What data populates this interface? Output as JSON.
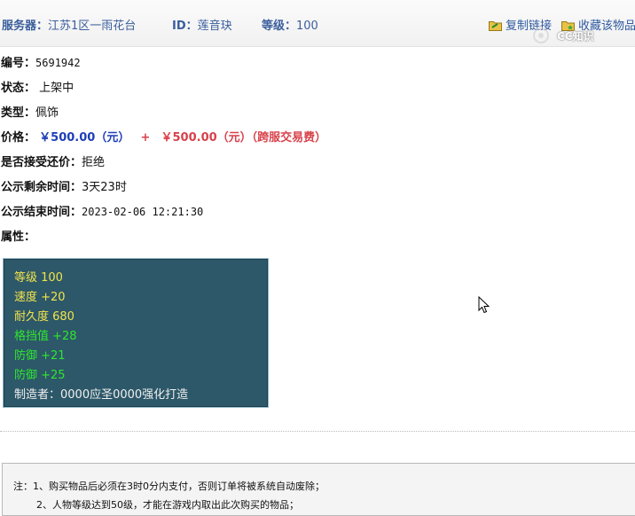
{
  "header": {
    "server_label": "服务器：",
    "server_value": "江苏1区一雨花台",
    "id_label": "ID：",
    "id_value": "莲音玦",
    "level_label": "等级：",
    "level_value": "100",
    "copy_link_label": "复制链接",
    "favorite_label": "收藏该物品"
  },
  "watermark": {
    "text": "CC知识"
  },
  "details": {
    "number_label": "编号：",
    "number_value": "5691942",
    "status_label": "状态：",
    "status_value": "上架中",
    "type_label": "类型：",
    "type_value": "佩饰",
    "price_label": "价格：",
    "price_main": "￥500.00（元）",
    "price_plus": "+",
    "price_fee": "￥500.00（元）（跨服交易费）",
    "counter_offer_label": "是否接受还价：",
    "counter_offer_value": "拒绝",
    "remaining_label": "公示剩余时间：",
    "remaining_value": "3天23时",
    "end_label": "公示结束时间：",
    "end_value": "2023-02-06 12:21:30",
    "attributes_label": "属性："
  },
  "attributes": [
    {
      "text": "等级 100",
      "color": "#f2e34a"
    },
    {
      "text": "速度 +20",
      "color": "#f2e34a"
    },
    {
      "text": "耐久度 680",
      "color": "#f2e34a"
    },
    {
      "text": "格挡值 +28",
      "color": "#2ee62e"
    },
    {
      "text": "防御 +21",
      "color": "#2ee62e"
    },
    {
      "text": "防御 +25",
      "color": "#2ee62e"
    },
    {
      "text": "制造者：0000应圣0000强化打造",
      "color": "#f0f0f0"
    }
  ],
  "notes": {
    "line1": "注：1、购买物品后必须在3时0分内支付，否则订单将被系统自动废除；",
    "line2": "2、人物等级达到50级，才能在游戏内取出此次购买的物品；"
  },
  "colors": {
    "header_text": "#3a5e9c",
    "price_blue": "#1e3fb7",
    "price_red": "#d8424b",
    "attr_panel_bg": "#2d5869"
  }
}
